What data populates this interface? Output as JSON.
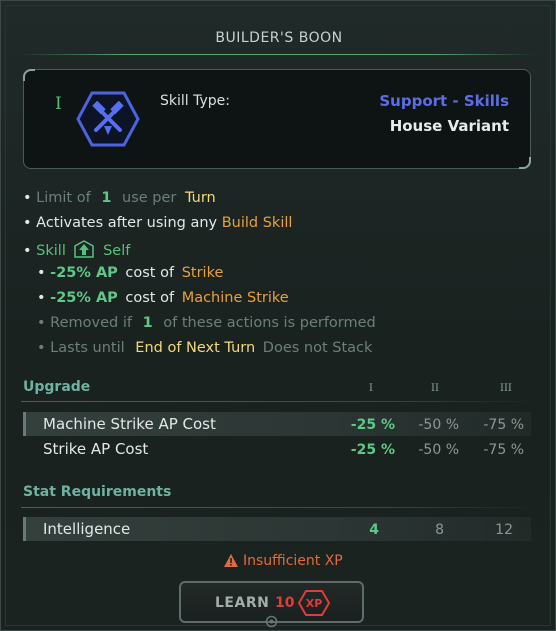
{
  "title": "BUILDER'S BOON",
  "header": {
    "tier": "I",
    "skill_type_label": "Skill Type:",
    "category": "Support - Skills",
    "variant": "House Variant",
    "icon": "crossed-hammers-hexagon-icon"
  },
  "details": {
    "limit": {
      "bullet": "•",
      "prefix": "Limit of",
      "count": "1",
      "mid": "use per",
      "unit": "Turn"
    },
    "activates": {
      "bullet": "•",
      "text": "Activates after using any",
      "target": "Build Skill"
    },
    "skill_target": {
      "bullet": "•",
      "label": "Skill",
      "target": "Self",
      "icon": "up-arrow-shield-icon"
    },
    "effects": [
      {
        "bullet": "•",
        "value": "-25% AP",
        "text": "cost of",
        "target": "Strike"
      },
      {
        "bullet": "•",
        "value": "-25% AP",
        "text": "cost of",
        "target": "Machine Strike"
      }
    ],
    "removed": {
      "bullet": "•",
      "prefix": "Removed if",
      "count": "1",
      "suffix": "of these actions is performed"
    },
    "lasts": {
      "bullet": "•",
      "prefix": "Lasts until",
      "duration": "End of Next Turn",
      "suffix": "Does not Stack"
    }
  },
  "upgrade": {
    "heading": "Upgrade",
    "tiers": [
      "I",
      "II",
      "III"
    ],
    "rows": [
      {
        "label": "Machine Strike AP Cost",
        "values": [
          "-25 %",
          "-50 %",
          "-75 %"
        ]
      },
      {
        "label": "Strike AP Cost",
        "values": [
          "-25 %",
          "-50 %",
          "-75 %"
        ]
      }
    ]
  },
  "stat_requirements": {
    "heading": "Stat Requirements",
    "rows": [
      {
        "label": "Intelligence",
        "values": [
          "4",
          "8",
          "12"
        ]
      }
    ]
  },
  "warning": {
    "text": "Insufficient XP",
    "icon": "warning-triangle-icon"
  },
  "learn": {
    "label": "LEARN",
    "cost": "10",
    "currency": "XP"
  },
  "colors": {
    "accent_green": "#5fc887",
    "skill_blue": "#5c6ee6",
    "highlight_gold": "#e7a23c",
    "highlight_yellow": "#f3d97d",
    "warning_orange": "#e36a3a",
    "cost_red": "#e33a3a"
  }
}
